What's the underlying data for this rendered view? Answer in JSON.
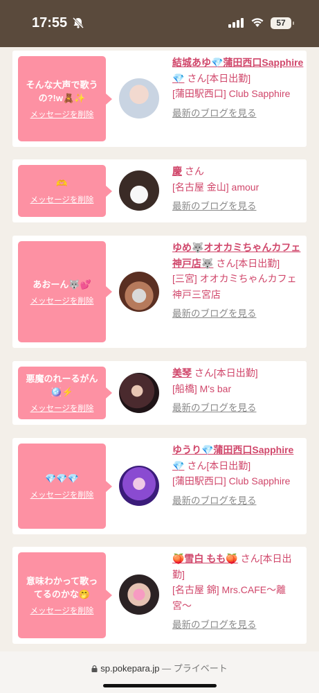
{
  "status_bar": {
    "time": "17:55",
    "battery": "57"
  },
  "cards": [
    {
      "message": "そんな大声で歌うの?!w🧸✨",
      "delete_label": "メッセージを削除",
      "name": "結城あゆ💎蒲田西口Sapphire💎",
      "san": "さん[本日出勤]",
      "shop": "[蒲田駅西口] Club Sapphire",
      "blog": "最新のブログを見る"
    },
    {
      "message": "🫶",
      "delete_label": "メッセージを削除",
      "name": "慶",
      "san": "さん",
      "shop": "[名古屋 金山] amour",
      "blog": "最新のブログを見る"
    },
    {
      "message": "あおーん🐺💕",
      "delete_label": "メッセージを削除",
      "name": "ゆめ🐺オオカミちゃんカフェ神戸店🐺",
      "san": "さん[本日出勤]",
      "shop": "[三宮] オオカミちゃんカフェ神戸三宮店",
      "blog": "最新のブログを見る"
    },
    {
      "message": "悪魔のれーるがん🪩⚡",
      "delete_label": "メッセージを削除",
      "name": "美琴",
      "san": "さん[本日出勤]",
      "shop": "[船橋] M's bar",
      "blog": "最新のブログを見る"
    },
    {
      "message": "💎💎💎",
      "delete_label": "メッセージを削除",
      "name": "ゆうり💎蒲田西口Sapphire💎",
      "san": "さん[本日出勤]",
      "shop": "[蒲田駅西口] Club Sapphire",
      "blog": "最新のブログを見る"
    },
    {
      "message": "意味わかって歌ってるのかな🤭",
      "delete_label": "メッセージを削除",
      "name": "🍑雪白 もも🍑",
      "san": "さん[本日出勤]",
      "shop": "[名古屋 錦] Mrs.CAFE〜離宮〜",
      "blog": "最新のブログを見る"
    }
  ],
  "browser": {
    "url": "sp.pokepara.jp",
    "privacy": "— プライベート"
  },
  "colors": {
    "accent_pink": "#fd91a3",
    "link_pink": "#d0466a",
    "status_bar": "#5a4a3c"
  }
}
